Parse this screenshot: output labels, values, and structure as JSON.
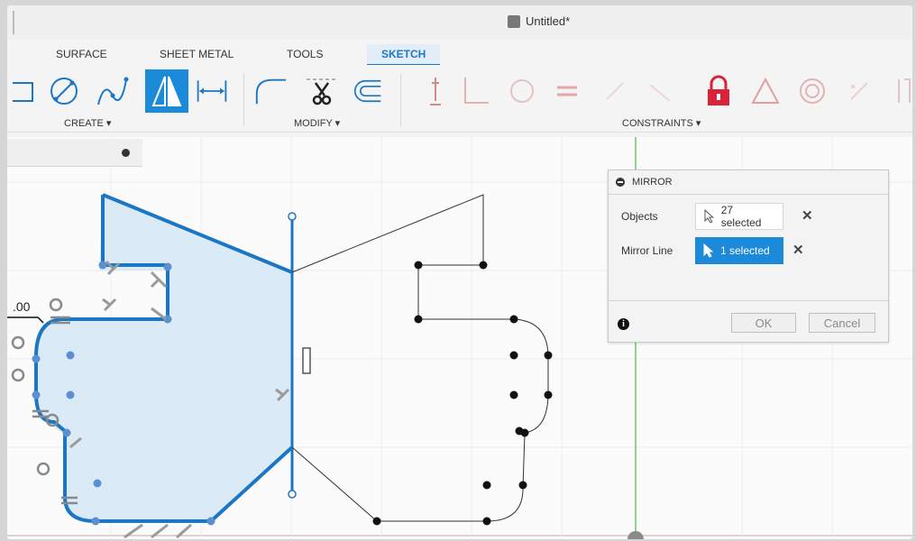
{
  "window": {
    "doc_title": "Untitled*"
  },
  "tabs": [
    {
      "label": "SURFACE"
    },
    {
      "label": "SHEET METAL"
    },
    {
      "label": "TOOLS"
    },
    {
      "label": "SKETCH"
    }
  ],
  "toolbar": {
    "create_label": "CREATE ▾",
    "modify_label": "MODIFY ▾",
    "constraints_label": "CONSTRAINTS ▾"
  },
  "mirror_dialog": {
    "title": "MIRROR",
    "objects_label": "Objects",
    "objects_value": "27 selected",
    "mirror_line_label": "Mirror Line",
    "mirror_line_value": "1 selected",
    "ok_label": "OK",
    "cancel_label": "Cancel",
    "info_glyph": "i"
  },
  "canvas": {
    "dimension_text": ".00"
  },
  "colors": {
    "accent": "#1a8ad9",
    "sketch_selected": "#1b77c4",
    "fill": "#dbeaf7",
    "lock": "#d9233a"
  }
}
